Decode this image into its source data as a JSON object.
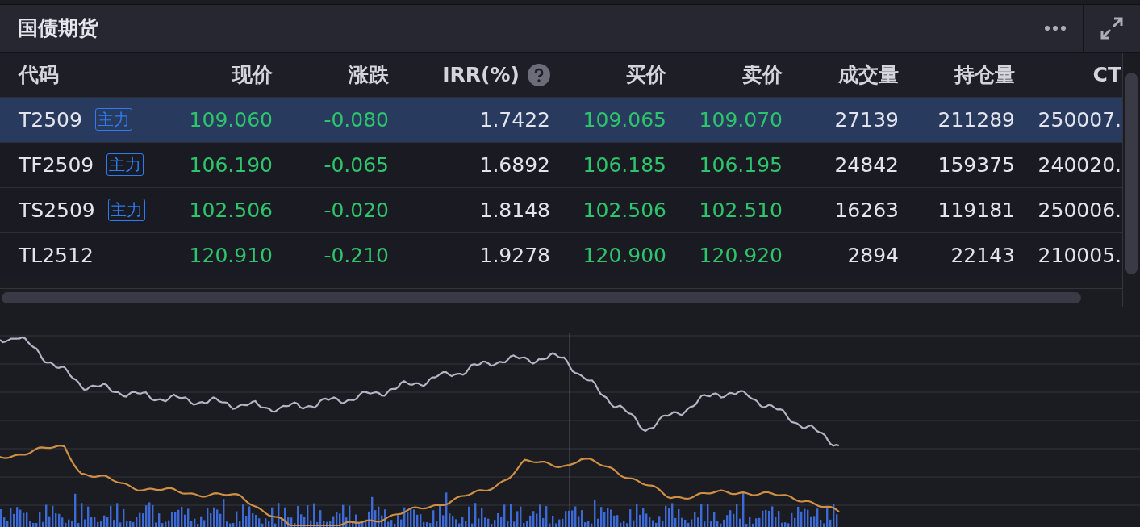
{
  "panel": {
    "title": "国债期货"
  },
  "table": {
    "columns": [
      {
        "label": "代码",
        "help": false
      },
      {
        "label": "现价",
        "help": false
      },
      {
        "label": "涨跌",
        "help": false
      },
      {
        "label": "IRR(%)",
        "help": true
      },
      {
        "label": "买价",
        "help": false
      },
      {
        "label": "卖价",
        "help": false
      },
      {
        "label": "成交量",
        "help": false
      },
      {
        "label": "持仓量",
        "help": false
      },
      {
        "label": "CT",
        "help": false
      }
    ],
    "rows": [
      {
        "selected": true,
        "falling": true,
        "code": "T2509",
        "tag": "主力",
        "price": "109.060",
        "change": "-0.080",
        "irr": "1.7422",
        "bid": "109.065",
        "ask": "109.070",
        "volume": "27139",
        "open_interest": "211289",
        "column_9": "250007."
      },
      {
        "selected": false,
        "falling": true,
        "code": "TF2509",
        "tag": "主力",
        "price": "106.190",
        "change": "-0.065",
        "irr": "1.6892",
        "bid": "106.185",
        "ask": "106.195",
        "volume": "24842",
        "open_interest": "159375",
        "column_9": "240020."
      },
      {
        "selected": false,
        "falling": true,
        "code": "TS2509",
        "tag": "主力",
        "price": "102.506",
        "change": "-0.020",
        "irr": "1.8148",
        "bid": "102.506",
        "ask": "102.510",
        "volume": "16263",
        "open_interest": "119181",
        "column_9": "250006."
      },
      {
        "selected": false,
        "falling": true,
        "code": "TL2512",
        "price": "120.910",
        "change": "-0.210",
        "irr": "1.9278",
        "bid": "120.900",
        "ask": "120.920",
        "volume": "2894",
        "open_interest": "22143",
        "column_9": "210005."
      }
    ]
  }
}
